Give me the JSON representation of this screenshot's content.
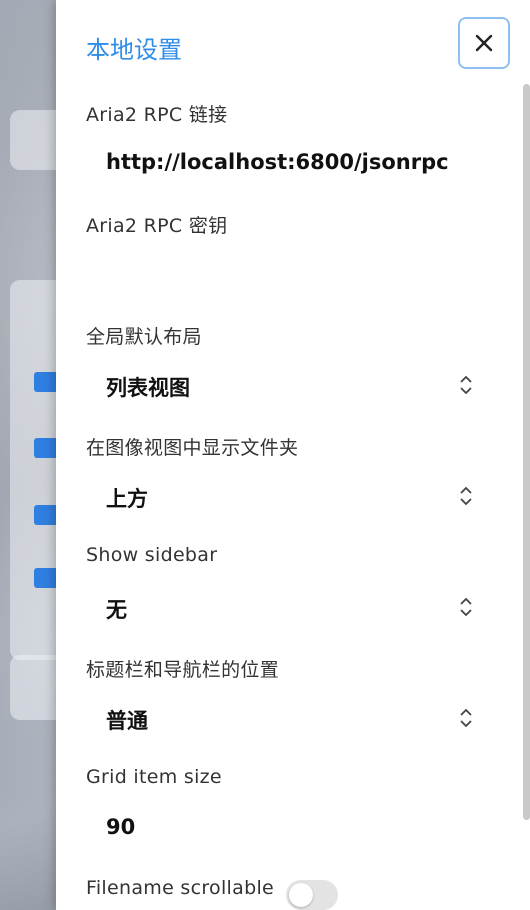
{
  "drawer": {
    "title": "本地设置",
    "close_icon": "close-icon"
  },
  "settings": {
    "rpc_url_label": "Aria2 RPC 链接",
    "rpc_url_value": "http://localhost:6800/jsonrpc",
    "rpc_secret_label": "Aria2 RPC 密钥",
    "rpc_secret_value": "",
    "layout_label": "全局默认布局",
    "layout_value": "列表视图",
    "folder_position_label": "在图像视图中显示文件夹",
    "folder_position_value": "上方",
    "sidebar_label": "Show sidebar",
    "sidebar_value": "无",
    "bar_position_label": "标题栏和导航栏的位置",
    "bar_position_value": "普通",
    "grid_size_label": "Grid item size",
    "grid_size_value": "90",
    "filename_scroll_label": "Filename scrollable",
    "filename_scroll_on": false
  }
}
